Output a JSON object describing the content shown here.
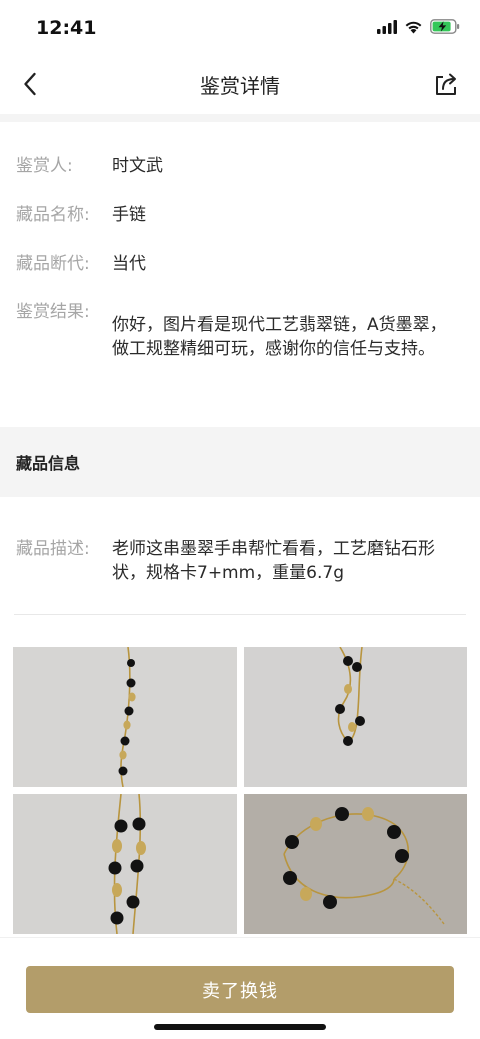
{
  "status": {
    "time": "12:41"
  },
  "nav": {
    "title": "鉴赏详情"
  },
  "appraisal": {
    "appraiser_label": "鉴赏人:",
    "appraiser_value": "时文武",
    "name_label": "藏品名称:",
    "name_value": "手链",
    "period_label": "藏品断代:",
    "period_value": "当代",
    "result_label": "鉴赏结果:",
    "result_value": "你好，图片看是现代工艺翡翠链，A货墨翠，做工规整精细可玩，感谢你的信任与支持。"
  },
  "collection_info": {
    "section_title": "藏品信息",
    "description_label": "藏品描述:",
    "description_value": "老师这串墨翠手串帮忙看看，工艺磨钻石形状，规格卡7+mm，重量6.7g"
  },
  "photos": [
    "bracelet-photo-1",
    "bracelet-photo-2",
    "bracelet-photo-3",
    "bracelet-photo-4"
  ],
  "footer": {
    "sell_button_label": "卖了换钱"
  },
  "colors": {
    "accent": "#b39d6a",
    "label_gray": "#a6a6a6",
    "section_bg": "#f4f4f4"
  }
}
